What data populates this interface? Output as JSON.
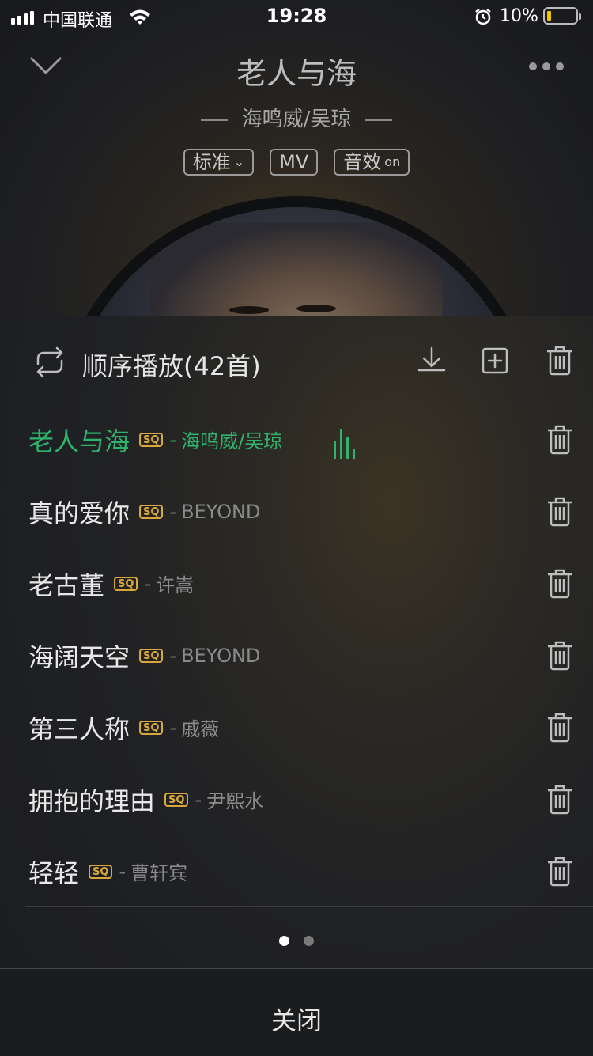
{
  "status_bar": {
    "carrier": "中国联通",
    "time": "19:28",
    "battery": "10%"
  },
  "now_playing": {
    "title": "老人与海",
    "artist": "海鸣威/吴琼",
    "chips": [
      {
        "label": "标准",
        "suffix": "⌄"
      },
      {
        "label": "MV",
        "suffix": ""
      },
      {
        "label": "音效",
        "suffix": "on"
      }
    ]
  },
  "playlist": {
    "mode_label": "顺序播放(42首)",
    "active_color": "#2fb36c",
    "sq_color": "#d9a83a",
    "items": [
      {
        "title": "老人与海",
        "badge": "SQ",
        "sep": "-",
        "artist": "海鸣威/吴琼",
        "active": true
      },
      {
        "title": "真的爱你",
        "badge": "SQ",
        "sep": "-",
        "artist": "BEYOND",
        "active": false
      },
      {
        "title": "老古董",
        "badge": "SQ",
        "sep": "-",
        "artist": "许嵩",
        "active": false
      },
      {
        "title": "海阔天空",
        "badge": "SQ",
        "sep": "-",
        "artist": "BEYOND",
        "active": false
      },
      {
        "title": "第三人称",
        "badge": "SQ",
        "sep": "-",
        "artist": "戚薇",
        "active": false
      },
      {
        "title": "拥抱的理由",
        "badge": "SQ",
        "sep": "-",
        "artist": "尹熙水",
        "active": false
      },
      {
        "title": "轻轻",
        "badge": "SQ",
        "sep": "-",
        "artist": "曹轩宾",
        "active": false
      }
    ],
    "page_index": 1,
    "page_count": 2,
    "close_label": "关闭"
  }
}
